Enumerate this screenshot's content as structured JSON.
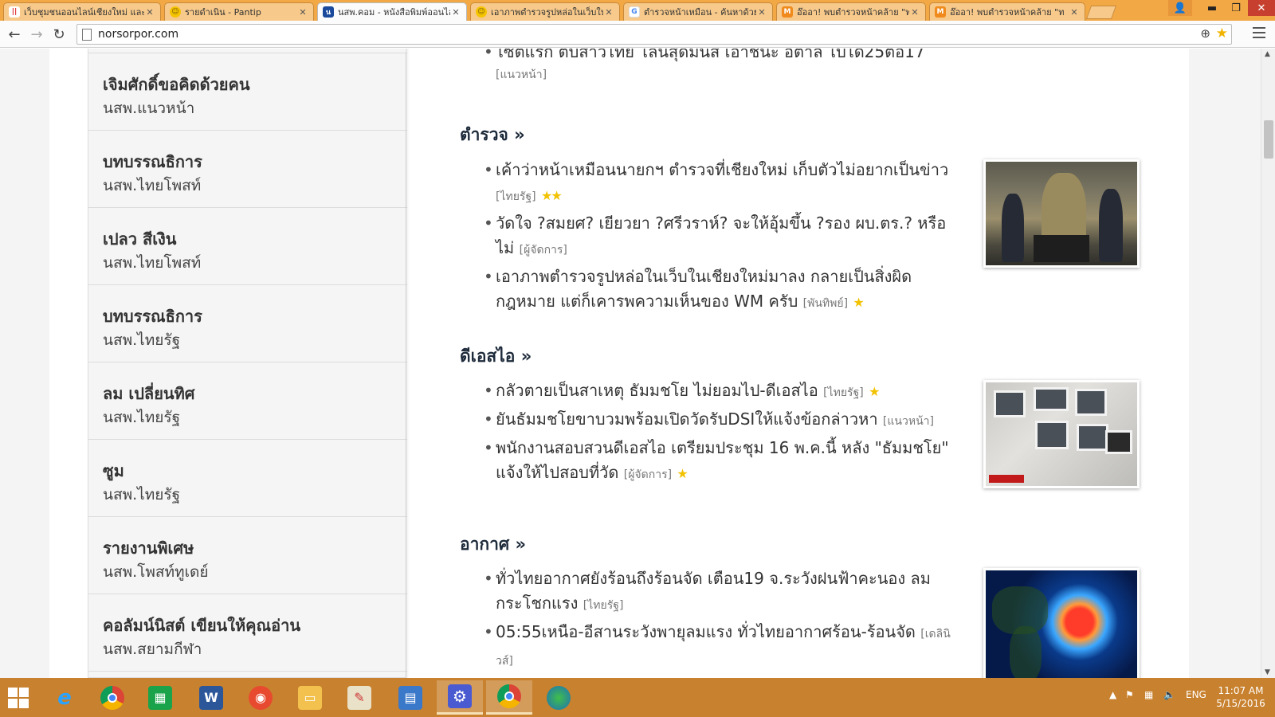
{
  "browser": {
    "tabs": [
      {
        "title": "เว็บชุมชนออนไลน์เชียงใหม่ และ",
        "favicon": "pantip-red-bars-icon"
      },
      {
        "title": "รายดำเนิน - Pantip",
        "favicon": "smiley-icon"
      },
      {
        "title": "นสพ.คอม - หนังสือพิมพ์ออนไล",
        "favicon": "norsorpor-icon",
        "active": true
      },
      {
        "title": "เอาภาพตำรวจรูปหล่อในเว็บในเ",
        "favicon": "smiley-icon"
      },
      {
        "title": "ตำรวจหน้าเหมือน - ค้นหาด้วย",
        "favicon": "google-icon"
      },
      {
        "title": "อ๊ออา! พบตำรวจหน้าคล้าย \"ท",
        "favicon": "m-orange-icon"
      },
      {
        "title": "อ๊ออา! พบตำรวจหน้าคล้าย \"ท",
        "favicon": "m-orange-icon"
      }
    ],
    "url": "norsorpor.com",
    "window_controls": {
      "minimize": "▬",
      "restore": "❐",
      "close": "✕"
    },
    "user_icon": "👤"
  },
  "sidebar": {
    "items": [
      {
        "title": "เจิมศักดิ์ขอคิดด้วยคน",
        "source": "นสพ.แนวหน้า"
      },
      {
        "title": "บทบรรณธิการ",
        "source": "นสพ.ไทยโพสท์"
      },
      {
        "title": "เปลว สีเงิน",
        "source": "นสพ.ไทยโพสท์"
      },
      {
        "title": "บทบรรณธิการ",
        "source": "นสพ.ไทยรัฐ"
      },
      {
        "title": "ลม เปลี่ยนทิศ",
        "source": "นสพ.ไทยรัฐ"
      },
      {
        "title": "ซูม",
        "source": "นสพ.ไทยรัฐ"
      },
      {
        "title": "รายงานพิเศษ",
        "source": "นสพ.โพสท์ทูเดย์"
      },
      {
        "title": "คอลัมน์นิสต์ เขียนให้คุณอ่าน",
        "source": "นสพ.สยามกีฬา"
      }
    ]
  },
  "main": {
    "top_item": {
      "text": "เซตแรก ตบสาวไทย โลนสุดมันส์ เอาชนะ อิตาลี ไปได้25ต่อ17",
      "source": "[แนวหน้า]"
    },
    "sections": [
      {
        "heading": "ตำรวจ »",
        "items": [
          {
            "text": "เค้าว่าหน้าเหมือนนายกฯ ตำรวจที่เชียงใหม่ เก็บตัวไม่อยากเป็นข่าว",
            "source": "[ไทยรัฐ]",
            "stars": "★★"
          },
          {
            "text": "วัดใจ ?สมยศ? เยียวยา ?ศรีวราห์? จะให้อุ้มขึ้น ?รอง ผบ.ตร.? หรือไม่",
            "source": "[ผู้จัดการ]",
            "stars": ""
          },
          {
            "text": "เอาภาพตำรวจรูปหล่อในเว็บในเชียงใหม่มาลง กลายเป็นสิ่งผิดกฎหมาย แต่ก็เคารพความเห็นของ WM ครับ",
            "source": "[พันทิพย์]",
            "stars": "★"
          }
        ]
      },
      {
        "heading": "ดีเอสไอ »",
        "items": [
          {
            "text": "กลัวตายเป็นสาเหตุ ธัมมชโย ไม่ยอมไป-ดีเอสไอ",
            "source": "[ไทยรัฐ]",
            "stars": "★"
          },
          {
            "text": "ยันธัมมชโยขาบวมพร้อมเปิดวัดรับDSIให้แจ้งข้อกล่าวหา",
            "source": "[แนวหน้า]",
            "stars": ""
          },
          {
            "text": "พนักงานสอบสวนดีเอสไอ เตรียมประชุม 16 พ.ค.นี้ หลัง \"ธัมมชโย\" แจ้งให้ไปสอบที่วัด",
            "source": "[ผู้จัดการ]",
            "stars": "★"
          }
        ]
      },
      {
        "heading": "อากาศ »",
        "items": [
          {
            "text": "ทั่วไทยอากาศยังร้อนถึงร้อนจัด เตือน19 จ.ระวังฝนฟ้าคะนอง ลมกระโชกแรง",
            "source": "[ไทยรัฐ]",
            "stars": ""
          },
          {
            "text": "05:55เหนือ-อีสานระวังพายุลมแรง ทั่วไทยอากาศร้อน-ร้อนจัด",
            "source": "[เดลินิวส์]",
            "stars": ""
          }
        ]
      }
    ]
  },
  "taskbar": {
    "apps": [
      "internet-explorer-icon",
      "chrome-icon",
      "store-icon",
      "word-icon",
      "flame-app-icon",
      "file-explorer-icon",
      "paint-icon",
      "control-panel-icon",
      "settings-gear-icon",
      "chrome-icon",
      "globe-app-icon"
    ],
    "language": "ENG",
    "time": "11:07 AM",
    "date": "5/15/2016"
  },
  "colors": {
    "tabstrip": "#f2a844",
    "taskbar": "#c8812e",
    "heading": "#1d2a3a",
    "star": "#f2c200"
  }
}
